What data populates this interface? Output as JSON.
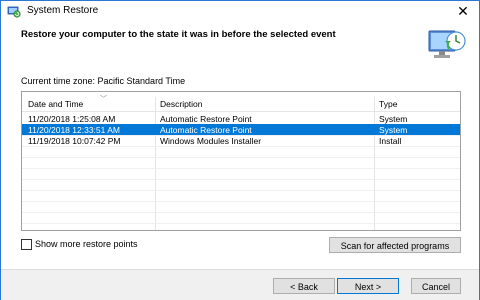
{
  "window": {
    "title": "System Restore",
    "close_glyph": "✕"
  },
  "header": {
    "instruction": "Restore your computer to the state it was in before the selected event"
  },
  "timezone_label": "Current time zone: Pacific Standard Time",
  "table": {
    "columns": [
      "Date and Time",
      "Description",
      "Type"
    ],
    "rows": [
      {
        "date": "11/20/2018 1:25:08 AM",
        "description": "Automatic Restore Point",
        "type": "System",
        "selected": false
      },
      {
        "date": "11/20/2018 12:33:51 AM",
        "description": "Automatic Restore Point",
        "type": "System",
        "selected": true
      },
      {
        "date": "11/19/2018 10:07:42 PM",
        "description": "Windows Modules Installer",
        "type": "Install",
        "selected": false
      }
    ]
  },
  "options": {
    "show_more_label": "Show more restore points",
    "show_more_checked": false
  },
  "buttons": {
    "scan": "Scan for affected programs",
    "back": "< Back",
    "next": "Next >",
    "cancel": "Cancel"
  },
  "icons": {
    "app": "system-restore-icon",
    "hero": "restore-computer-icon",
    "close": "close-icon",
    "sort": "sort-arrow-icon"
  },
  "colors": {
    "selection": "#0078d7",
    "window_border": "#2b78d0"
  }
}
